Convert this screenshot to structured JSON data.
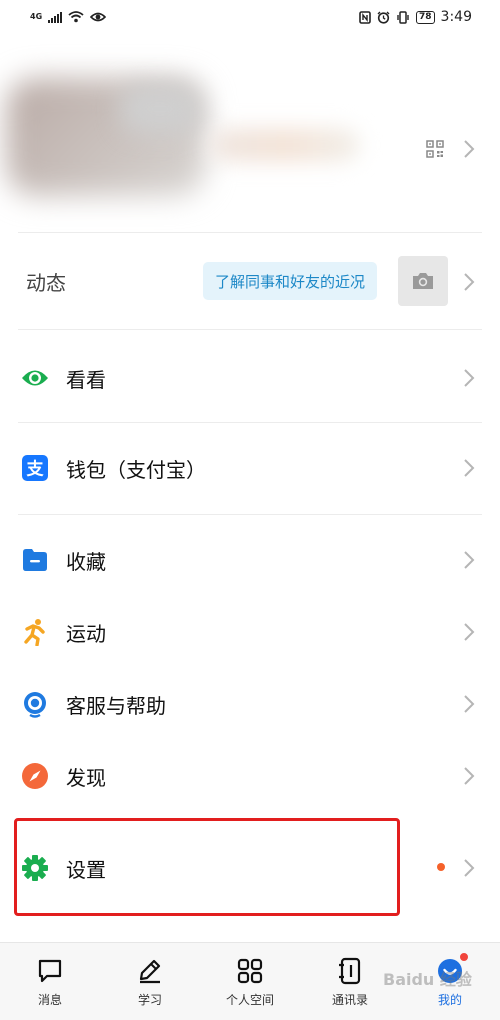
{
  "status_bar": {
    "network": "4G",
    "battery": "78",
    "time": "3:49"
  },
  "profile": {
    "qr_icon": "qr-code-icon",
    "chevron_icon": "chevron-right-icon"
  },
  "moments": {
    "label": "动态",
    "tip": "了解同事和好友的近况",
    "camera_icon": "camera-icon"
  },
  "menu": {
    "kankan": "看看",
    "wallet": "钱包（支付宝）",
    "favorites": "收藏",
    "sports": "运动",
    "support": "客服与帮助",
    "discover": "发现",
    "settings": "设置"
  },
  "tabbar": {
    "items": [
      {
        "label": "消息",
        "icon": "message-icon"
      },
      {
        "label": "学习",
        "icon": "pencil-icon"
      },
      {
        "label": "个人空间",
        "icon": "grid-icon"
      },
      {
        "label": "通讯录",
        "icon": "contacts-icon"
      },
      {
        "label": "我的",
        "icon": "profile-icon",
        "active": true
      }
    ]
  },
  "watermark": "Baidu 经验",
  "colors": {
    "highlight": "#e21e1e",
    "accent_blue": "#1d6fe0",
    "bubble_text": "#1d88c7",
    "green": "#1aad4f",
    "orange": "#f5a623",
    "red_dot": "#f5612a"
  }
}
